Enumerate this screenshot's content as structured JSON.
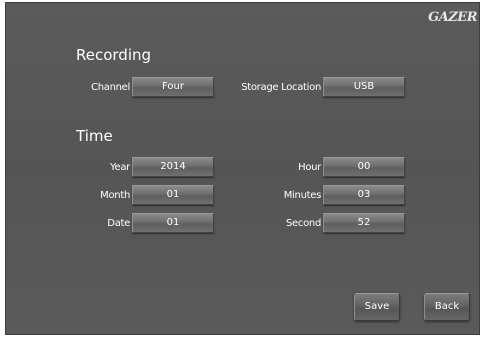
{
  "brand": "GAZER",
  "recording": {
    "title": "Recording",
    "channel_label": "Channel",
    "channel_value": "Four",
    "storage_label": "Storage Location",
    "storage_value": "USB"
  },
  "time": {
    "title": "Time",
    "year_label": "Year",
    "year_value": "2014",
    "month_label": "Month",
    "month_value": "01",
    "date_label": "Date",
    "date_value": "01",
    "hour_label": "Hour",
    "hour_value": "00",
    "minutes_label": "Minutes",
    "minutes_value": "03",
    "second_label": "Second",
    "second_value": "52"
  },
  "buttons": {
    "save": "Save",
    "back": "Back"
  }
}
